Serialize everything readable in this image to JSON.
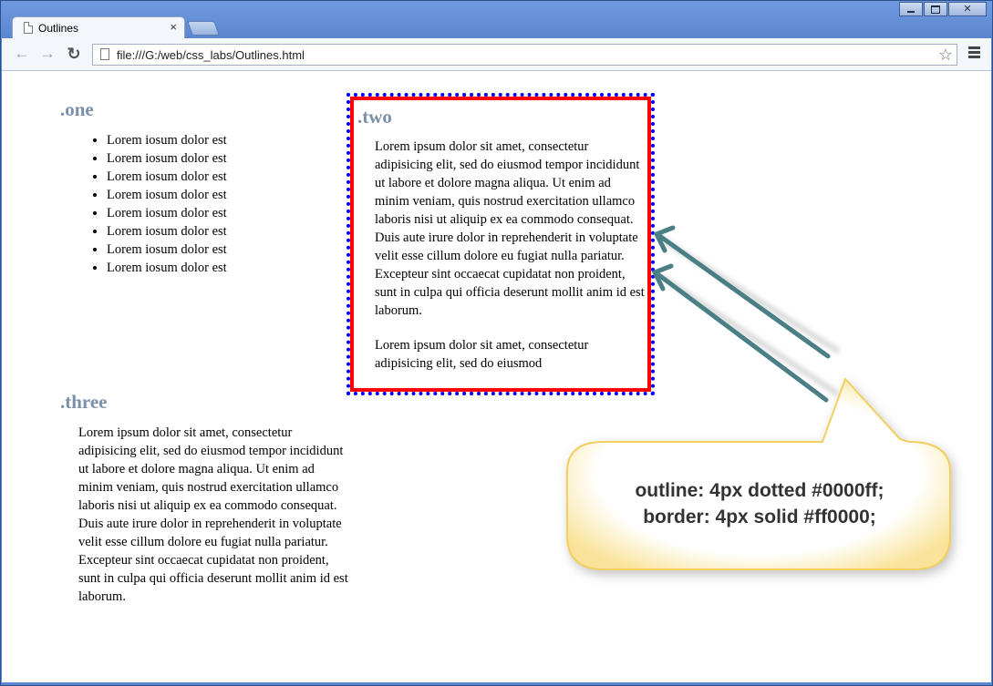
{
  "window": {
    "controls": {
      "minimize": "minimize",
      "maximize": "maximize",
      "close": "✕"
    }
  },
  "tab": {
    "title": "Outlines",
    "close_glyph": "×"
  },
  "toolbar": {
    "back_glyph": "←",
    "forward_glyph": "→",
    "reload_glyph": "↻",
    "url": "file:///G:/web/css_labs/Outlines.html",
    "star_glyph": "☆"
  },
  "page": {
    "one": {
      "heading": ".one",
      "items": [
        "Lorem iosum dolor est",
        "Lorem iosum dolor est",
        "Lorem iosum dolor est",
        "Lorem iosum dolor est",
        "Lorem iosum dolor est",
        "Lorem iosum dolor est",
        "Lorem iosum dolor est",
        "Lorem iosum dolor est"
      ]
    },
    "two": {
      "heading": ".two",
      "para1": "Lorem ipsum dolor sit amet, consectetur adipisicing elit, sed do eiusmod tempor incididunt ut labore et dolore magna aliqua. Ut enim ad minim veniam, quis nostrud exercitation ullamco laboris nisi ut aliquip ex ea commodo consequat. Duis aute irure dolor in reprehenderit in voluptate velit esse cillum dolore eu fugiat nulla pariatur. Excepteur sint occaecat cupidatat non proident, sunt in culpa qui officia deserunt mollit anim id est laborum.",
      "para2": "Lorem ipsum dolor sit amet, consectetur adipisicing elit, sed do eiusmod"
    },
    "three": {
      "heading": ".three",
      "para": "Lorem ipsum dolor sit amet, consectetur adipisicing elit, sed do eiusmod tempor incididunt ut labore et dolore magna aliqua. Ut enim ad minim veniam, quis nostrud exercitation ullamco laboris nisi ut aliquip ex ea commodo consequat. Duis aute irure dolor in reprehenderit in voluptate velit esse cillum dolore eu fugiat nulla pariatur. Excepteur sint occaecat cupidatat non proident, sunt in culpa qui officia deserunt mollit anim id est laborum."
    }
  },
  "callout": {
    "line1": "outline: 4px dotted #0000ff;",
    "line2": "border: 4px solid #ff0000;"
  },
  "colors": {
    "outline": "#0000ff",
    "border": "#ff0000",
    "arrow": "#4a7f86",
    "heading": "#7a90a8",
    "callout_fill": "#ffffff",
    "callout_glow": "#f7d36a"
  },
  "icons": {
    "tab_page": "page-icon",
    "omnibox_page": "doc-icon",
    "bookmark": "star-icon",
    "menu": "menu-icon"
  }
}
